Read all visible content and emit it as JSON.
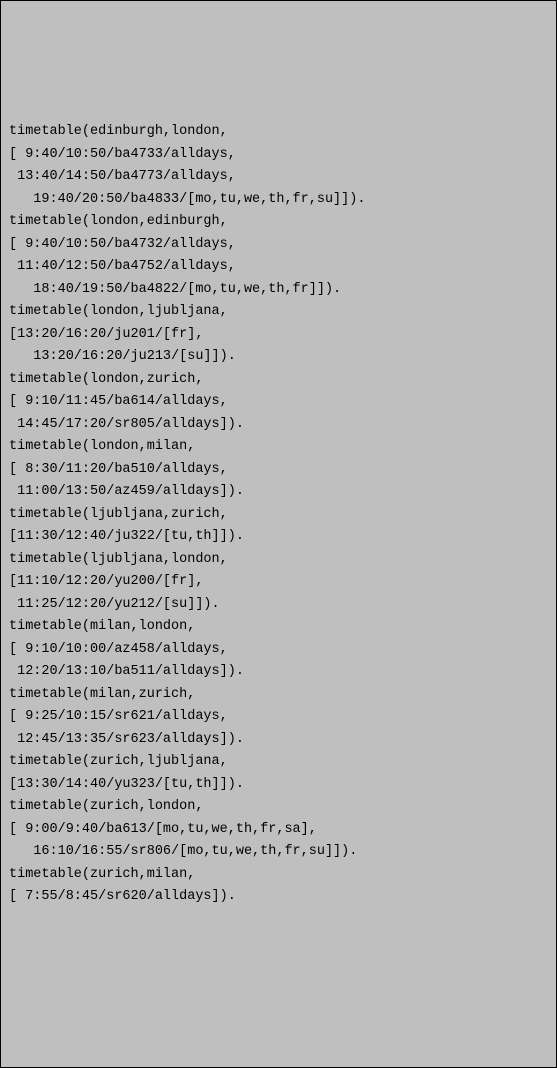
{
  "lines": [
    "timetable(edinburgh,london,",
    "[ 9:40/10:50/ba4733/alldays,",
    " 13:40/14:50/ba4773/alldays,",
    "   19:40/20:50/ba4833/[mo,tu,we,th,fr,su]]).",
    "",
    "timetable(london,edinburgh,",
    "[ 9:40/10:50/ba4732/alldays,",
    " 11:40/12:50/ba4752/alldays,",
    "   18:40/19:50/ba4822/[mo,tu,we,th,fr]]).",
    "",
    "timetable(london,ljubljana,",
    "[13:20/16:20/ju201/[fr],",
    "   13:20/16:20/ju213/[su]]).",
    "",
    "timetable(london,zurich,",
    "[ 9:10/11:45/ba614/alldays,",
    " 14:45/17:20/sr805/alldays]).",
    "",
    "timetable(london,milan,",
    "[ 8:30/11:20/ba510/alldays,",
    " 11:00/13:50/az459/alldays]).",
    "",
    "timetable(ljubljana,zurich,",
    "[11:30/12:40/ju322/[tu,th]]).",
    "",
    "timetable(ljubljana,london,",
    "[11:10/12:20/yu200/[fr],",
    " 11:25/12:20/yu212/[su]]).",
    "",
    "timetable(milan,london,",
    "[ 9:10/10:00/az458/alldays,",
    " 12:20/13:10/ba511/alldays]).",
    "",
    "timetable(milan,zurich,",
    "[ 9:25/10:15/sr621/alldays,",
    " 12:45/13:35/sr623/alldays]).",
    "",
    "timetable(zurich,ljubljana,",
    "[13:30/14:40/yu323/[tu,th]]).",
    "",
    "timetable(zurich,london,",
    "[ 9:00/9:40/ba613/[mo,tu,we,th,fr,sa],",
    "   16:10/16:55/sr806/[mo,tu,we,th,fr,su]]).",
    "",
    "timetable(zurich,milan,",
    "[ 7:55/8:45/sr620/alldays])."
  ]
}
